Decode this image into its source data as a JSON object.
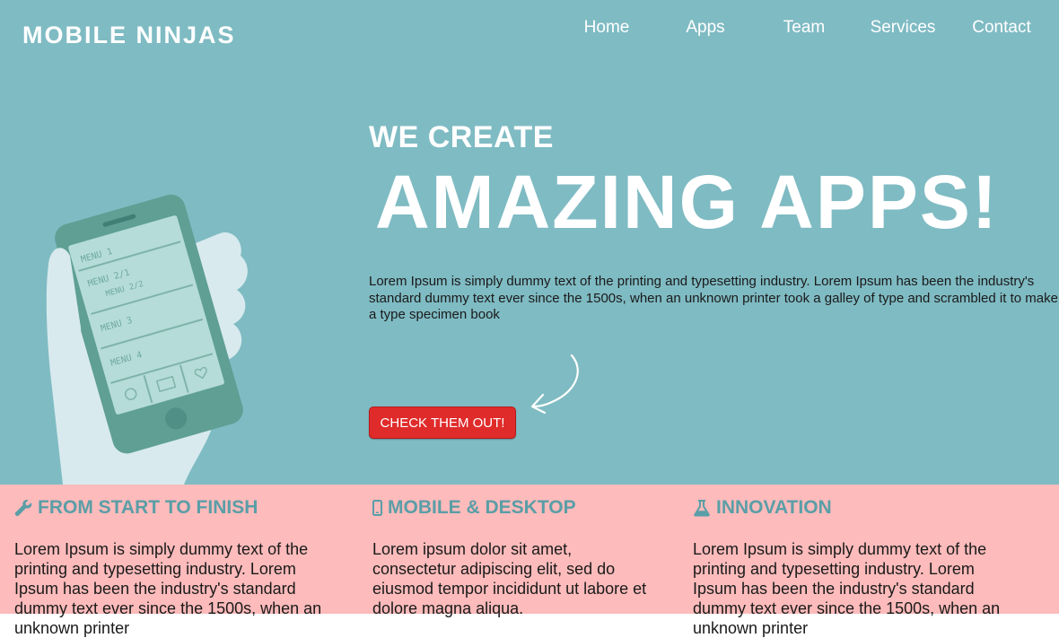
{
  "brand": {
    "logo_text": "MOBILE NINJAS"
  },
  "nav": {
    "items": [
      {
        "label": "Home"
      },
      {
        "label": "Apps"
      },
      {
        "label": "Team"
      },
      {
        "label": "Services"
      },
      {
        "label": "Contact"
      }
    ]
  },
  "hero": {
    "kicker": "WE CREATE",
    "headline": "AMAZING APPS!",
    "description": "Lorem Ipsum is simply dummy text of the printing and typesetting industry. Lorem Ipsum has been the industry's standard dummy text ever since the 1500s, when an unknown printer took a galley of type and scrambled it to make a type specimen book",
    "cta_label": "CHECK THEM OUT!",
    "illustration": {
      "icon": "hand-holding-phone-illustration",
      "menu_items": [
        "MENU 1",
        "MENU 2/1",
        "MENU 2/2",
        "MENU 3",
        "MENU 4"
      ]
    }
  },
  "features": [
    {
      "icon": "wrench-icon",
      "title": "FROM START TO FINISH",
      "text": "Lorem Ipsum is simply dummy text of the printing and typesetting industry. Lorem Ipsum has been the industry's standard dummy text ever since the 1500s, when an unknown printer"
    },
    {
      "icon": "mobile-icon",
      "title": "MOBILE & DESKTOP",
      "text": "Lorem ipsum dolor sit amet, consectetur adipiscing elit, sed do eiusmod tempor incididunt ut labore et dolore magna aliqua."
    },
    {
      "icon": "flask-icon",
      "title": "INNOVATION",
      "text": "Lorem Ipsum is simply dummy text of the printing and typesetting industry. Lorem Ipsum has been the industry's standard dummy text ever since the 1500s, when an unknown printer"
    }
  ],
  "colors": {
    "hero_background": "#7fbbc3",
    "features_background": "#fdbbbb",
    "accent_teal": "#5a9ea7",
    "cta_red": "#e02b2b",
    "text_white": "#ffffff"
  }
}
